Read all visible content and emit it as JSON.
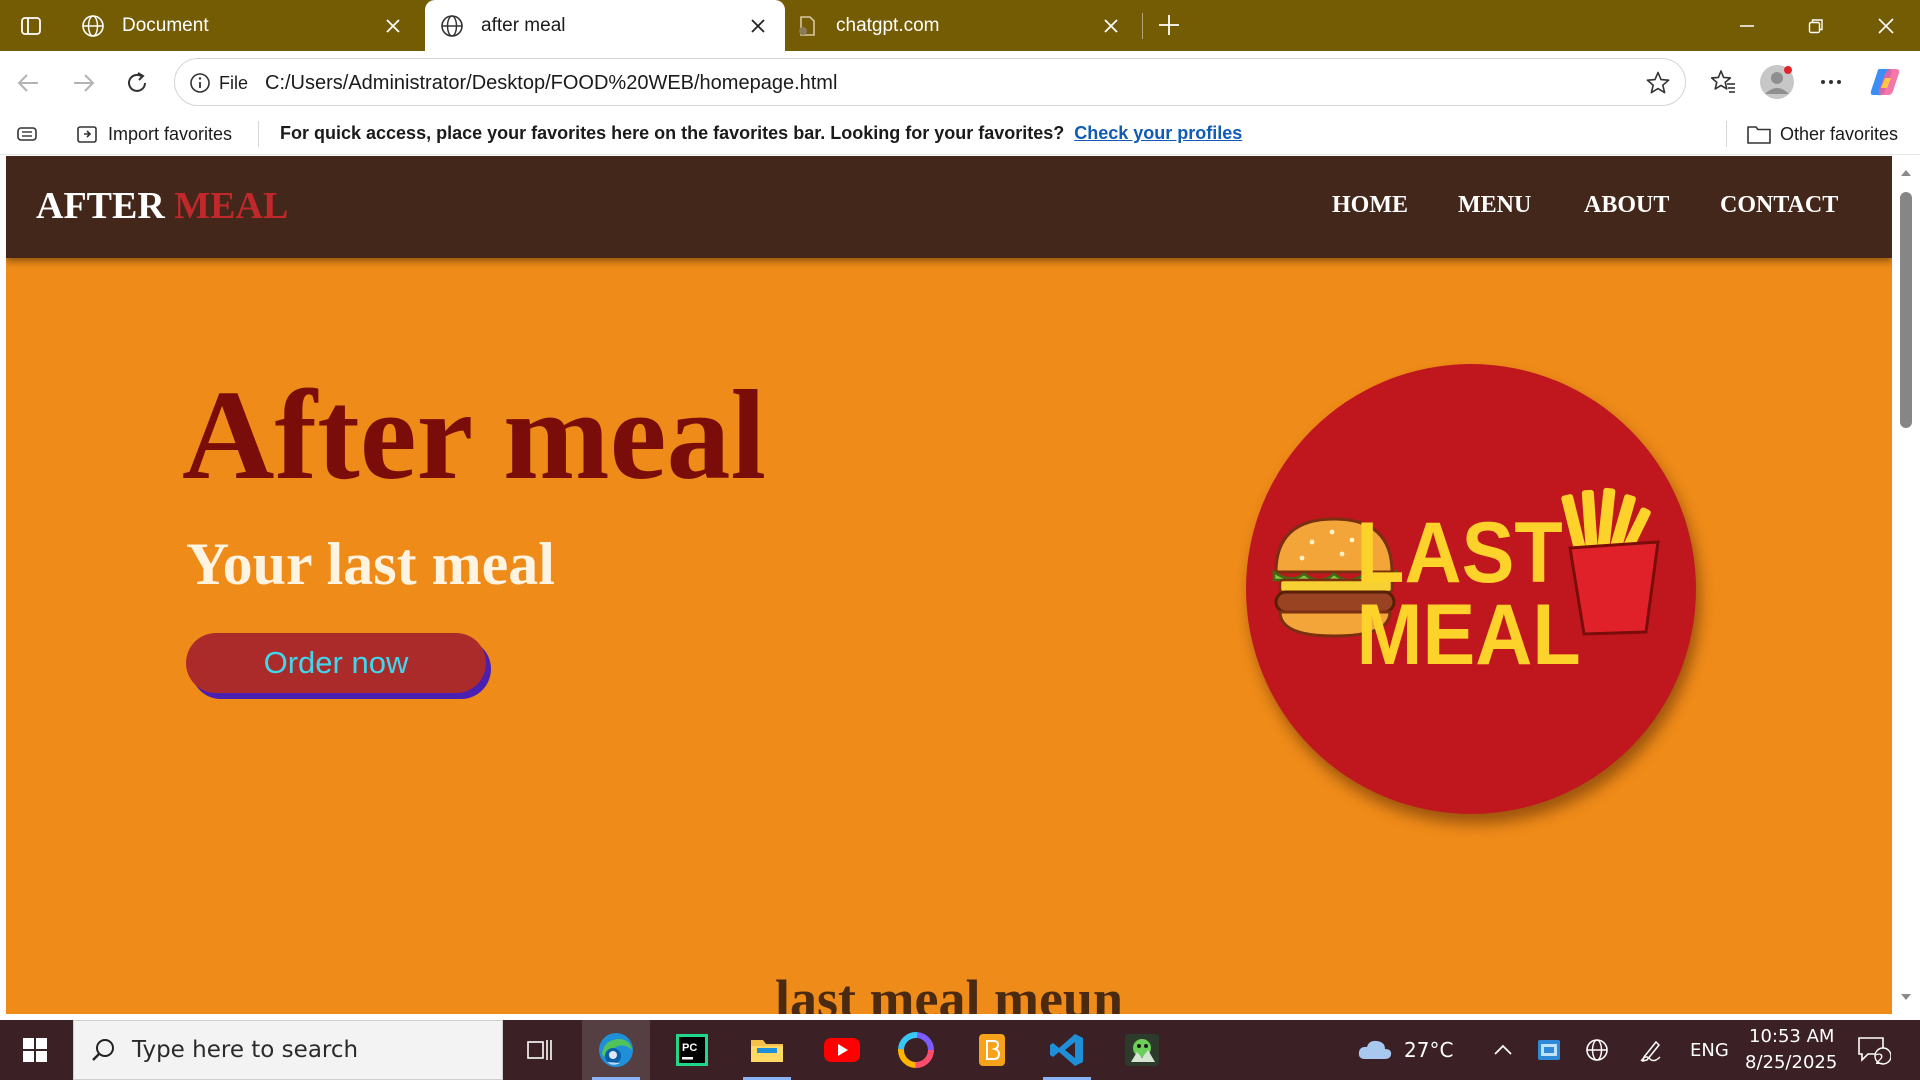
{
  "browser": {
    "tabs": [
      {
        "title": "Document",
        "active": false
      },
      {
        "title": "after meal",
        "active": true
      },
      {
        "title": "chatgpt.com",
        "active": false
      }
    ],
    "address": {
      "scheme_label": "File",
      "url": "C:/Users/Administrator/Desktop/FOOD%20WEB/homepage.html"
    },
    "favorites_bar": {
      "import_label": "Import favorites",
      "message": "For quick access, place your favorites here on the favorites bar. Looking for your favorites?",
      "link": "Check your profiles",
      "other_label": "Other favorites"
    },
    "colors": {
      "tab_strip": "#745c05",
      "link": "#0f5bb5"
    }
  },
  "page": {
    "nav": {
      "logo_word1": "AFTER",
      "logo_word2": "MEAL",
      "links": [
        "HOME",
        "MENU",
        "ABOUT",
        "CONTACT"
      ]
    },
    "hero": {
      "title": "After meal",
      "subtitle": "Your last meal",
      "cta": "Order now"
    },
    "logo_badge": {
      "line1": "LAST",
      "line2": "MEAL"
    },
    "section_title": "last meal meun",
    "colors": {
      "background": "#ef8b18",
      "nav": "#43271a",
      "title": "#7a0d09",
      "accent": "#c0282b",
      "badge": "#c0171e",
      "badge_text": "#fdd22a"
    }
  },
  "taskbar": {
    "search_placeholder": "Type here to search",
    "apps": [
      "task-view-icon",
      "edge-icon",
      "pycharm-icon",
      "file-explorer-icon",
      "youtube-icon",
      "color-app-icon",
      "notes-app-icon",
      "vscode-icon",
      "game-app-icon"
    ],
    "weather": "27°C",
    "language": "ENG",
    "time": "10:53 AM",
    "date": "8/25/2025",
    "notifications": "2"
  }
}
